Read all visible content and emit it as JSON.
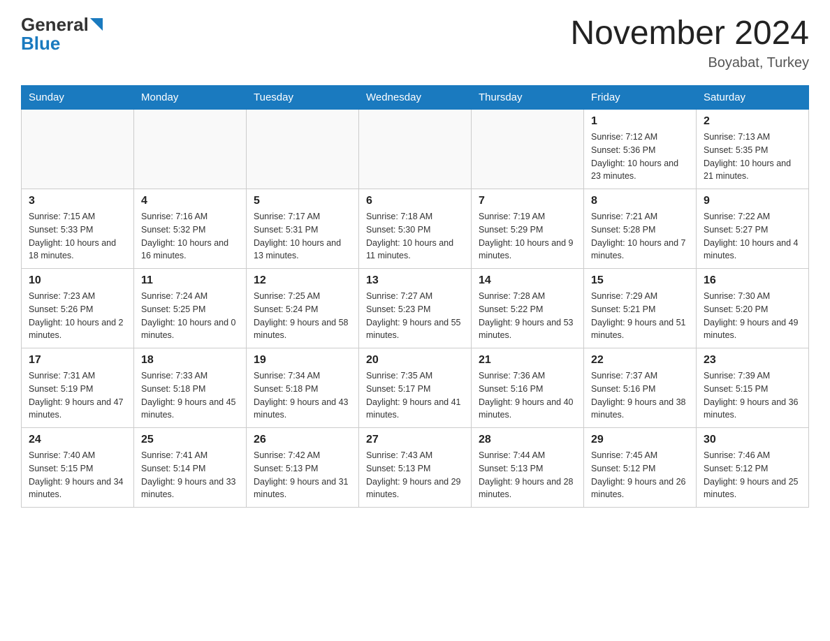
{
  "header": {
    "logo_general": "General",
    "logo_blue": "Blue",
    "month_title": "November 2024",
    "location": "Boyabat, Turkey"
  },
  "days_of_week": [
    "Sunday",
    "Monday",
    "Tuesday",
    "Wednesday",
    "Thursday",
    "Friday",
    "Saturday"
  ],
  "weeks": [
    {
      "days": [
        {
          "number": "",
          "info": ""
        },
        {
          "number": "",
          "info": ""
        },
        {
          "number": "",
          "info": ""
        },
        {
          "number": "",
          "info": ""
        },
        {
          "number": "",
          "info": ""
        },
        {
          "number": "1",
          "info": "Sunrise: 7:12 AM\nSunset: 5:36 PM\nDaylight: 10 hours and 23 minutes."
        },
        {
          "number": "2",
          "info": "Sunrise: 7:13 AM\nSunset: 5:35 PM\nDaylight: 10 hours and 21 minutes."
        }
      ]
    },
    {
      "days": [
        {
          "number": "3",
          "info": "Sunrise: 7:15 AM\nSunset: 5:33 PM\nDaylight: 10 hours and 18 minutes."
        },
        {
          "number": "4",
          "info": "Sunrise: 7:16 AM\nSunset: 5:32 PM\nDaylight: 10 hours and 16 minutes."
        },
        {
          "number": "5",
          "info": "Sunrise: 7:17 AM\nSunset: 5:31 PM\nDaylight: 10 hours and 13 minutes."
        },
        {
          "number": "6",
          "info": "Sunrise: 7:18 AM\nSunset: 5:30 PM\nDaylight: 10 hours and 11 minutes."
        },
        {
          "number": "7",
          "info": "Sunrise: 7:19 AM\nSunset: 5:29 PM\nDaylight: 10 hours and 9 minutes."
        },
        {
          "number": "8",
          "info": "Sunrise: 7:21 AM\nSunset: 5:28 PM\nDaylight: 10 hours and 7 minutes."
        },
        {
          "number": "9",
          "info": "Sunrise: 7:22 AM\nSunset: 5:27 PM\nDaylight: 10 hours and 4 minutes."
        }
      ]
    },
    {
      "days": [
        {
          "number": "10",
          "info": "Sunrise: 7:23 AM\nSunset: 5:26 PM\nDaylight: 10 hours and 2 minutes."
        },
        {
          "number": "11",
          "info": "Sunrise: 7:24 AM\nSunset: 5:25 PM\nDaylight: 10 hours and 0 minutes."
        },
        {
          "number": "12",
          "info": "Sunrise: 7:25 AM\nSunset: 5:24 PM\nDaylight: 9 hours and 58 minutes."
        },
        {
          "number": "13",
          "info": "Sunrise: 7:27 AM\nSunset: 5:23 PM\nDaylight: 9 hours and 55 minutes."
        },
        {
          "number": "14",
          "info": "Sunrise: 7:28 AM\nSunset: 5:22 PM\nDaylight: 9 hours and 53 minutes."
        },
        {
          "number": "15",
          "info": "Sunrise: 7:29 AM\nSunset: 5:21 PM\nDaylight: 9 hours and 51 minutes."
        },
        {
          "number": "16",
          "info": "Sunrise: 7:30 AM\nSunset: 5:20 PM\nDaylight: 9 hours and 49 minutes."
        }
      ]
    },
    {
      "days": [
        {
          "number": "17",
          "info": "Sunrise: 7:31 AM\nSunset: 5:19 PM\nDaylight: 9 hours and 47 minutes."
        },
        {
          "number": "18",
          "info": "Sunrise: 7:33 AM\nSunset: 5:18 PM\nDaylight: 9 hours and 45 minutes."
        },
        {
          "number": "19",
          "info": "Sunrise: 7:34 AM\nSunset: 5:18 PM\nDaylight: 9 hours and 43 minutes."
        },
        {
          "number": "20",
          "info": "Sunrise: 7:35 AM\nSunset: 5:17 PM\nDaylight: 9 hours and 41 minutes."
        },
        {
          "number": "21",
          "info": "Sunrise: 7:36 AM\nSunset: 5:16 PM\nDaylight: 9 hours and 40 minutes."
        },
        {
          "number": "22",
          "info": "Sunrise: 7:37 AM\nSunset: 5:16 PM\nDaylight: 9 hours and 38 minutes."
        },
        {
          "number": "23",
          "info": "Sunrise: 7:39 AM\nSunset: 5:15 PM\nDaylight: 9 hours and 36 minutes."
        }
      ]
    },
    {
      "days": [
        {
          "number": "24",
          "info": "Sunrise: 7:40 AM\nSunset: 5:15 PM\nDaylight: 9 hours and 34 minutes."
        },
        {
          "number": "25",
          "info": "Sunrise: 7:41 AM\nSunset: 5:14 PM\nDaylight: 9 hours and 33 minutes."
        },
        {
          "number": "26",
          "info": "Sunrise: 7:42 AM\nSunset: 5:13 PM\nDaylight: 9 hours and 31 minutes."
        },
        {
          "number": "27",
          "info": "Sunrise: 7:43 AM\nSunset: 5:13 PM\nDaylight: 9 hours and 29 minutes."
        },
        {
          "number": "28",
          "info": "Sunrise: 7:44 AM\nSunset: 5:13 PM\nDaylight: 9 hours and 28 minutes."
        },
        {
          "number": "29",
          "info": "Sunrise: 7:45 AM\nSunset: 5:12 PM\nDaylight: 9 hours and 26 minutes."
        },
        {
          "number": "30",
          "info": "Sunrise: 7:46 AM\nSunset: 5:12 PM\nDaylight: 9 hours and 25 minutes."
        }
      ]
    }
  ]
}
